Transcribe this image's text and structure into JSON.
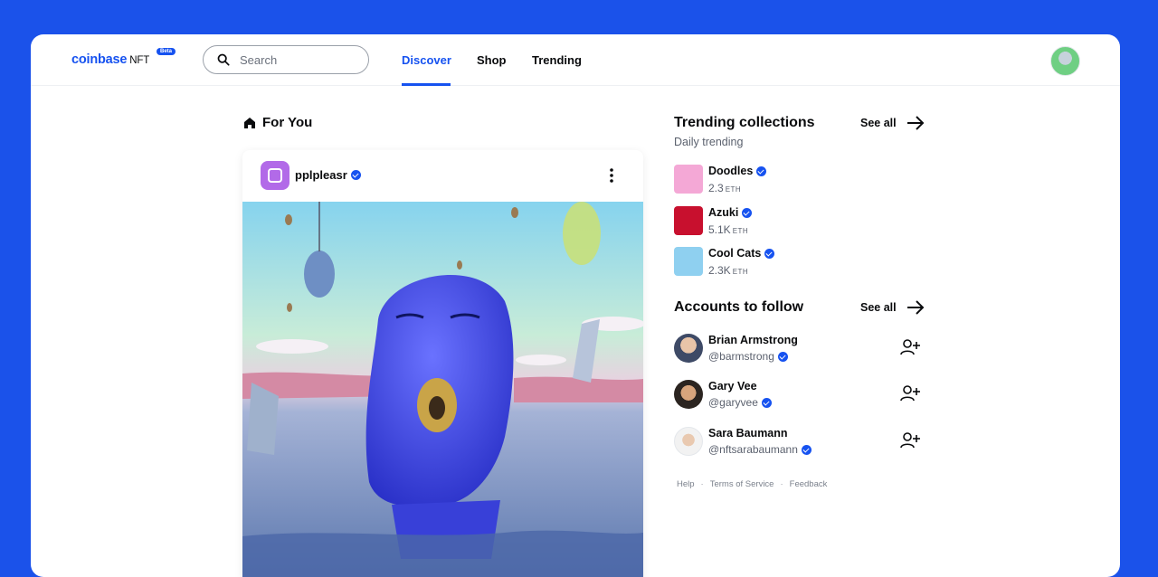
{
  "header": {
    "logo": "coinbase",
    "logo_suffix": "NFT",
    "badge": "Beta",
    "search_placeholder": "Search",
    "tabs": [
      {
        "label": "Discover",
        "active": true
      },
      {
        "label": "Shop",
        "active": false
      },
      {
        "label": "Trending",
        "active": false
      }
    ]
  },
  "feed": {
    "title": "For You",
    "post": {
      "username": "pplpleasr",
      "verified": true
    }
  },
  "trending": {
    "title": "Trending collections",
    "subtitle": "Daily trending",
    "see_all": "See all",
    "items": [
      {
        "name": "Doodles",
        "value": "2.3",
        "unit": "ETH",
        "verified": true,
        "color": "#f4a8d6"
      },
      {
        "name": "Azuki",
        "value": "5.1K",
        "unit": "ETH",
        "verified": true,
        "color": "#c8102e"
      },
      {
        "name": "Cool Cats",
        "value": "2.3K",
        "unit": "ETH",
        "verified": true,
        "color": "#8fd0f0"
      }
    ]
  },
  "accounts": {
    "title": "Accounts to follow",
    "see_all": "See all",
    "items": [
      {
        "name": "Brian Armstrong",
        "handle": "@barmstrong",
        "verified": true
      },
      {
        "name": "Gary Vee",
        "handle": "@garyvee",
        "verified": true
      },
      {
        "name": "Sara Baumann",
        "handle": "@nftsarabaumann",
        "verified": true
      }
    ]
  },
  "footer": {
    "links": [
      "Help",
      "Terms of Service",
      "Feedback"
    ]
  },
  "colors": {
    "accent": "#1652f0",
    "background": "#1b52ea"
  }
}
